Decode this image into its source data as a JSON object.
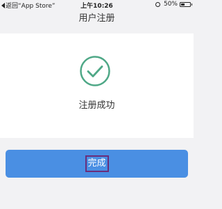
{
  "status_bar": {
    "back_text": "返回“App Store”",
    "time": "上午10:26",
    "battery_percent": "50%",
    "battery_level": 0.5,
    "alarm_icon": "alarm-icon",
    "back_icon": "back-triangle-icon"
  },
  "nav": {
    "title": "用户注册"
  },
  "content": {
    "success_icon": "check-circle-icon",
    "success_color": "#4fa887",
    "success_text": "注册成功"
  },
  "actions": {
    "done_label": "完成",
    "button_color": "#4a8fe3",
    "highlight_color": "#6b2d7a"
  }
}
